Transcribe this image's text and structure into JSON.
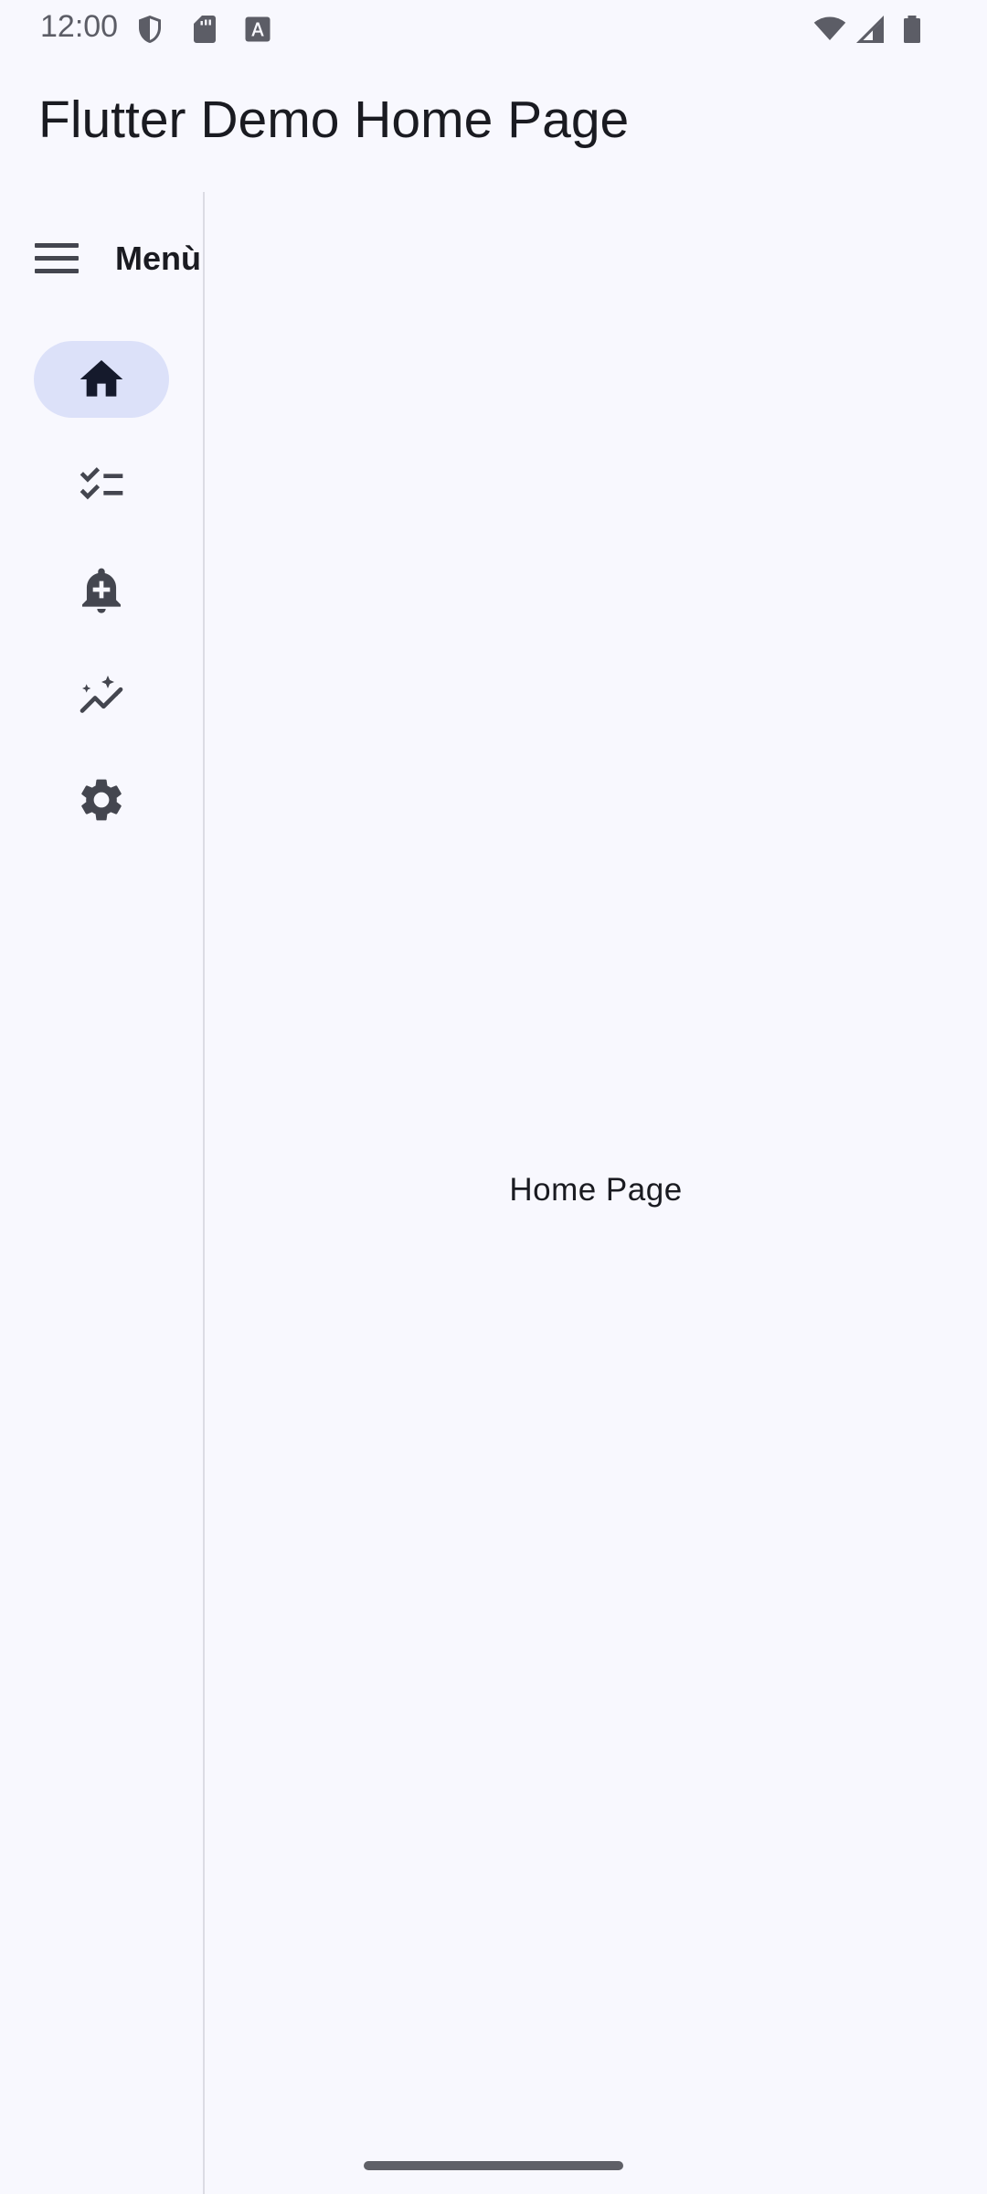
{
  "status_bar": {
    "time": "12:00",
    "icons": [
      "shield-icon",
      "sd-card-icon",
      "font-a-icon",
      "wifi-icon",
      "signal-icon",
      "battery-icon"
    ],
    "color": "#5c5d66"
  },
  "app_bar": {
    "title": "Flutter Demo Home Page"
  },
  "nav_rail": {
    "menu_label": "Menù",
    "menu_icon": "menu-icon",
    "destinations": [
      {
        "icon": "home-icon",
        "selected": true
      },
      {
        "icon": "checklist-icon",
        "selected": false
      },
      {
        "icon": "add-alert-icon",
        "selected": false
      },
      {
        "icon": "insights-icon",
        "selected": false
      },
      {
        "icon": "settings-icon",
        "selected": false
      }
    ],
    "selected_indicator_color": "#dce1f9"
  },
  "main": {
    "text": "Home Page"
  },
  "colors": {
    "background": "#f8f8fe",
    "on_surface": "#1a1b21",
    "icon": "#44464f"
  }
}
